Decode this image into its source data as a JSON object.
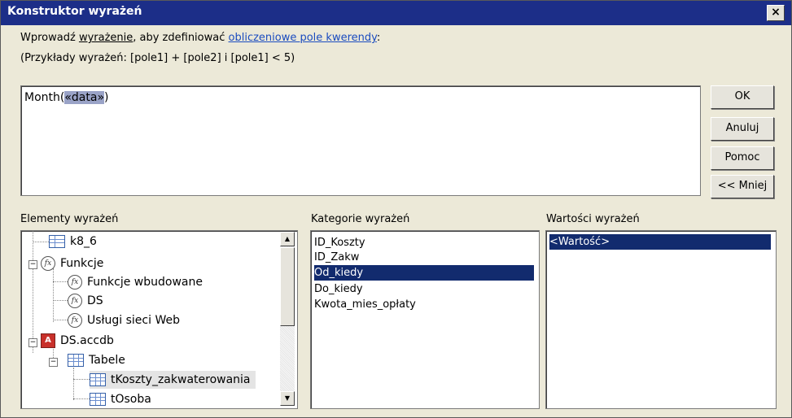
{
  "window": {
    "title": "Konstruktor wyrażeń",
    "close_label": "×"
  },
  "instructions": {
    "line1_prefix": "Wprowadź ",
    "line1_underlined": "wyrażenie",
    "line1_middle": ", aby zdefiniować ",
    "line1_link": "obliczeniowe pole kwerendy",
    "line1_suffix": ":",
    "line2": "(Przykłady wyrażeń: [pole1] + [pole2] i [pole1] < 5)"
  },
  "expression": {
    "prefix": "Month(",
    "placeholder": "«data»",
    "suffix": ")"
  },
  "buttons": {
    "ok": "OK",
    "cancel": "Anuluj",
    "help": "Pomoc",
    "less": "<< Mniej"
  },
  "panes": {
    "elements_label": "Elementy wyrażeń",
    "categories_label": "Kategorie wyrażeń",
    "values_label": "Wartości wyrażeń"
  },
  "tree": [
    {
      "label": "k8_6",
      "icon": "query-icon"
    },
    {
      "label": "Funkcje",
      "icon": "function-icon",
      "expander": "−"
    },
    {
      "label": "Funkcje wbudowane",
      "icon": "function-icon"
    },
    {
      "label": "DS",
      "icon": "function-icon"
    },
    {
      "label": "Usługi sieci Web",
      "icon": "function-icon"
    },
    {
      "label": "DS.accdb",
      "icon": "database-icon",
      "expander": "−"
    },
    {
      "label": "Tabele",
      "icon": "table-icon",
      "expander": "−"
    },
    {
      "label": "tKoszty_zakwaterowania",
      "icon": "table-icon",
      "selected": true
    },
    {
      "label": "tOsoba",
      "icon": "table-icon"
    }
  ],
  "categories": [
    {
      "label": "ID_Koszty"
    },
    {
      "label": "ID_Zakw"
    },
    {
      "label": "Od_kiedy",
      "selected": true
    },
    {
      "label": "Do_kiedy"
    },
    {
      "label": "Kwota_mies_opłaty"
    }
  ],
  "values": [
    {
      "label": "<Wartość>",
      "selected": true
    }
  ],
  "scroll_arrows": {
    "up": "▲",
    "down": "▼"
  },
  "colors": {
    "title_bar": "#1c2e88",
    "selection": "#122b6e",
    "link": "#1a4bbf",
    "dialog_bg": "#ece9d8"
  }
}
